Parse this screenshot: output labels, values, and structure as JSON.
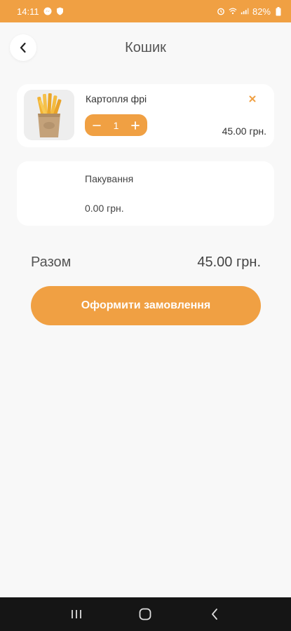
{
  "status": {
    "time": "14:11",
    "battery": "82%",
    "icons_left": [
      "messenger-icon",
      "shield-icon"
    ],
    "icons_right": [
      "alarm-icon",
      "wifi-icon",
      "signal-icon",
      "battery-icon"
    ]
  },
  "header": {
    "title": "Кошик",
    "back_icon": "chevron-left-icon"
  },
  "cart": {
    "items": [
      {
        "name": "Картопля фрі",
        "quantity": "1",
        "price": "45.00 грн.",
        "image": "french-fries"
      }
    ],
    "packaging": {
      "label": "Пакування",
      "price": "0.00 грн."
    }
  },
  "summary": {
    "total_label": "Разом",
    "total_value": "45.00 грн."
  },
  "checkout": {
    "label": "Оформити замовлення"
  },
  "colors": {
    "accent": "#f0a043",
    "background": "#f8f8f8",
    "card": "#ffffff",
    "navbar": "#151515"
  }
}
